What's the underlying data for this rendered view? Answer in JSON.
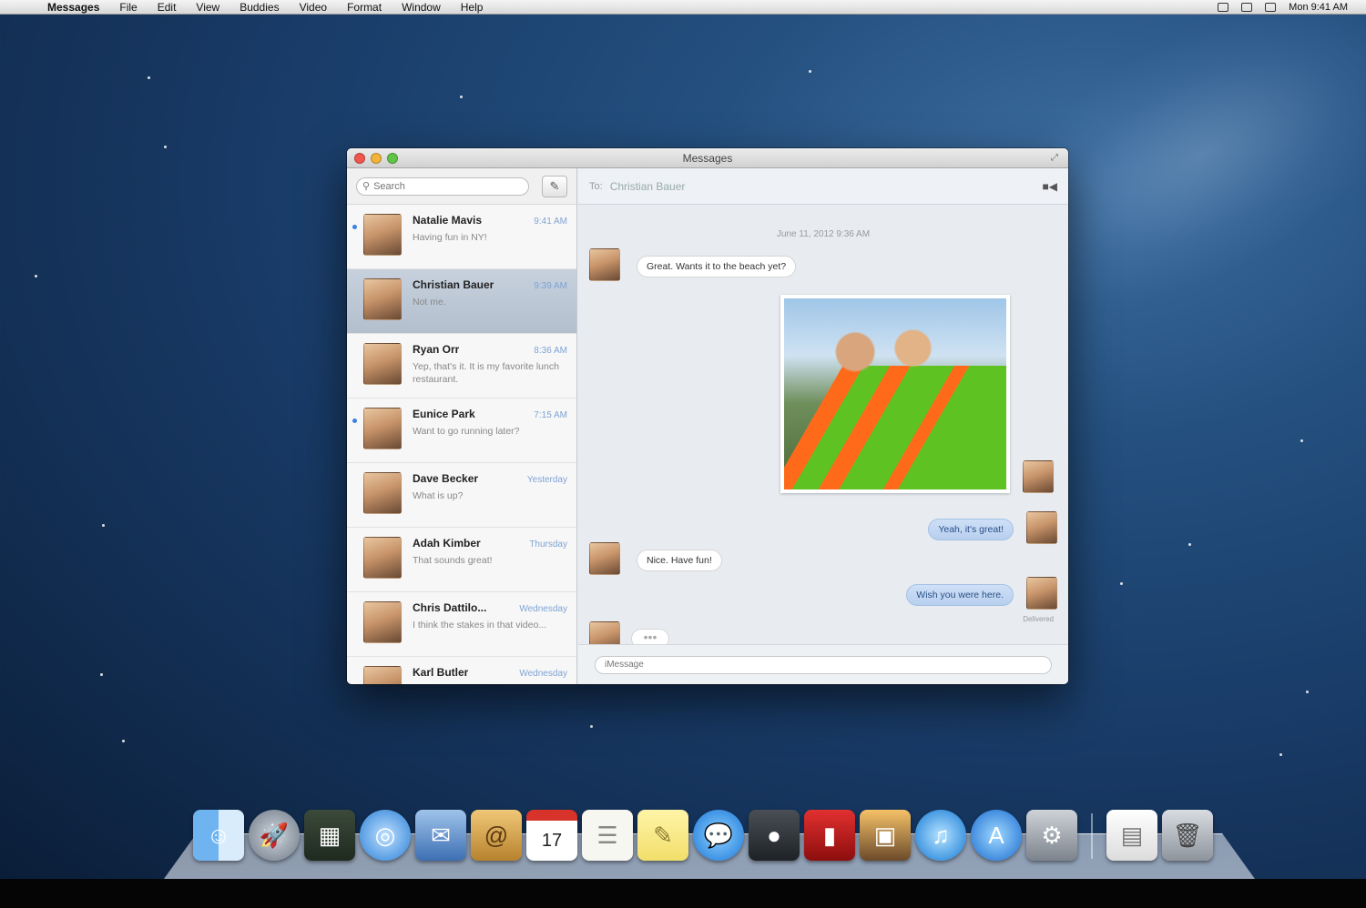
{
  "menubar": {
    "apple": "",
    "items": [
      "Messages",
      "File",
      "Edit",
      "View",
      "Buddies",
      "Video",
      "Format",
      "Window",
      "Help"
    ],
    "clock": "Mon 9:41 AM"
  },
  "window": {
    "title": "Messages"
  },
  "sidebar": {
    "search_placeholder": "Search",
    "compose_glyph": "✎",
    "conversations": [
      {
        "name": "Natalie Mavis",
        "time": "9:41 AM",
        "preview": "Having fun in NY!"
      },
      {
        "name": "Christian Bauer",
        "time": "9:39 AM",
        "preview": "Not me."
      },
      {
        "name": "Ryan Orr",
        "time": "8:36 AM",
        "preview": "Yep, that's it. It is my favorite lunch restaurant."
      },
      {
        "name": "Eunice Park",
        "time": "7:15 AM",
        "preview": "Want to go running later?"
      },
      {
        "name": "Dave Becker",
        "time": "Yesterday",
        "preview": "What is up?"
      },
      {
        "name": "Adah Kimber",
        "time": "Thursday",
        "preview": "That sounds great!"
      },
      {
        "name": "Chris Dattilo...",
        "time": "Wednesday",
        "preview": "I think the stakes in that video..."
      },
      {
        "name": "Karl Butler",
        "time": "Wednesday",
        "preview": ""
      }
    ]
  },
  "chat": {
    "to_label": "To:",
    "recipient": "Christian Bauer",
    "video_icon": "■◀",
    "timestamp": "June 11, 2012 9:36 AM",
    "messages": [
      {
        "text": "Great. Wants it to the beach yet?"
      },
      {
        "text": "Yeah, it's great!"
      },
      {
        "text": "Nice. Have fun!"
      },
      {
        "text": "Wish you were here."
      }
    ],
    "typing": "•••",
    "delivered": "Delivered",
    "compose_placeholder": "iMessage"
  },
  "dock": {
    "icons": [
      "finder-icon",
      "launchpad-icon",
      "mission-control-icon",
      "safari-icon",
      "mail-icon",
      "contacts-icon",
      "calendar-icon",
      "reminders-icon",
      "notes-icon",
      "messages-icon",
      "facetime-icon",
      "photo-booth-icon",
      "iphoto-icon",
      "itunes-icon",
      "app-store-icon",
      "system-preferences-icon",
      "documents-icon",
      "trash-icon"
    ],
    "calendar_day": "17"
  }
}
